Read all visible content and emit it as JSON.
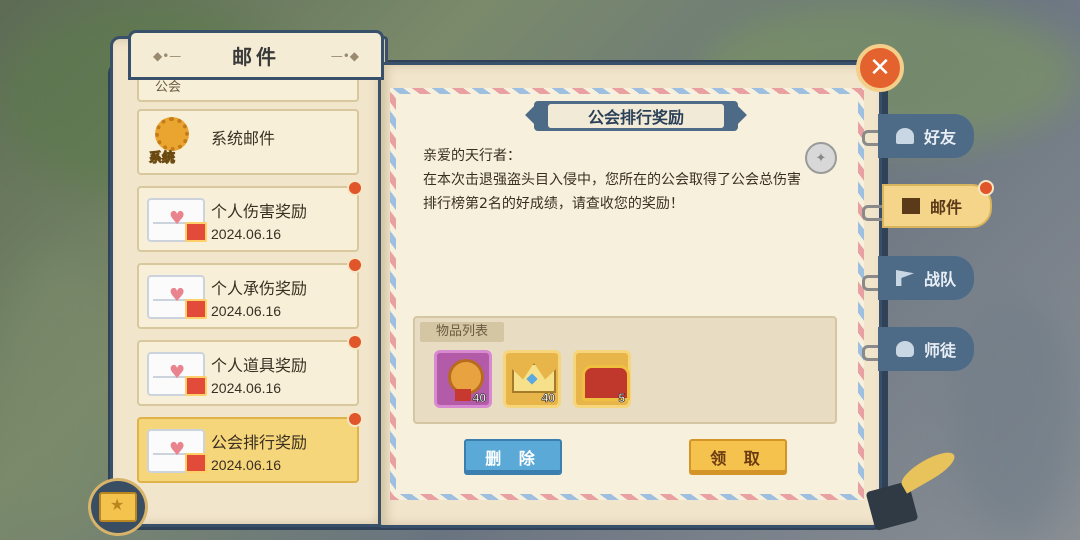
{
  "header": {
    "title": "邮件"
  },
  "mail_list": {
    "partial_item_label": "公会",
    "system_item": {
      "title": "系统邮件",
      "icon_label": "系统"
    },
    "items": [
      {
        "title": "个人伤害奖励",
        "date": "2024.06.16",
        "unread": true,
        "selected": false
      },
      {
        "title": "个人承伤奖励",
        "date": "2024.06.16",
        "unread": true,
        "selected": false
      },
      {
        "title": "个人道具奖励",
        "date": "2024.06.16",
        "unread": true,
        "selected": false
      },
      {
        "title": "公会排行奖励",
        "date": "2024.06.16",
        "unread": true,
        "selected": true
      }
    ]
  },
  "mail_detail": {
    "title": "公会排行奖励",
    "greeting": "亲爱的天行者：",
    "body": "在本次击退强盗头目入侵中，您所在的公会取得了公会总伤害排行榜第2名的好成绩，请查收您的奖励！",
    "items_label": "物品列表",
    "rewards": [
      {
        "icon": "guild-medal-icon",
        "count": "40"
      },
      {
        "icon": "crown-icon",
        "count": "40"
      },
      {
        "icon": "treasure-chest-icon",
        "count": "5"
      }
    ],
    "delete_label": "删 除",
    "claim_label": "领 取"
  },
  "side_tabs": [
    {
      "label": "好友",
      "icon": "friends-icon",
      "active": false
    },
    {
      "label": "邮件",
      "icon": "mail-icon",
      "active": true
    },
    {
      "label": "战队",
      "icon": "flag-icon",
      "active": false
    },
    {
      "label": "师徒",
      "icon": "mentor-icon",
      "active": false
    }
  ],
  "colors": {
    "accent": "#f6c24e",
    "frame": "#39506a",
    "unread_dot": "#e0552a"
  }
}
